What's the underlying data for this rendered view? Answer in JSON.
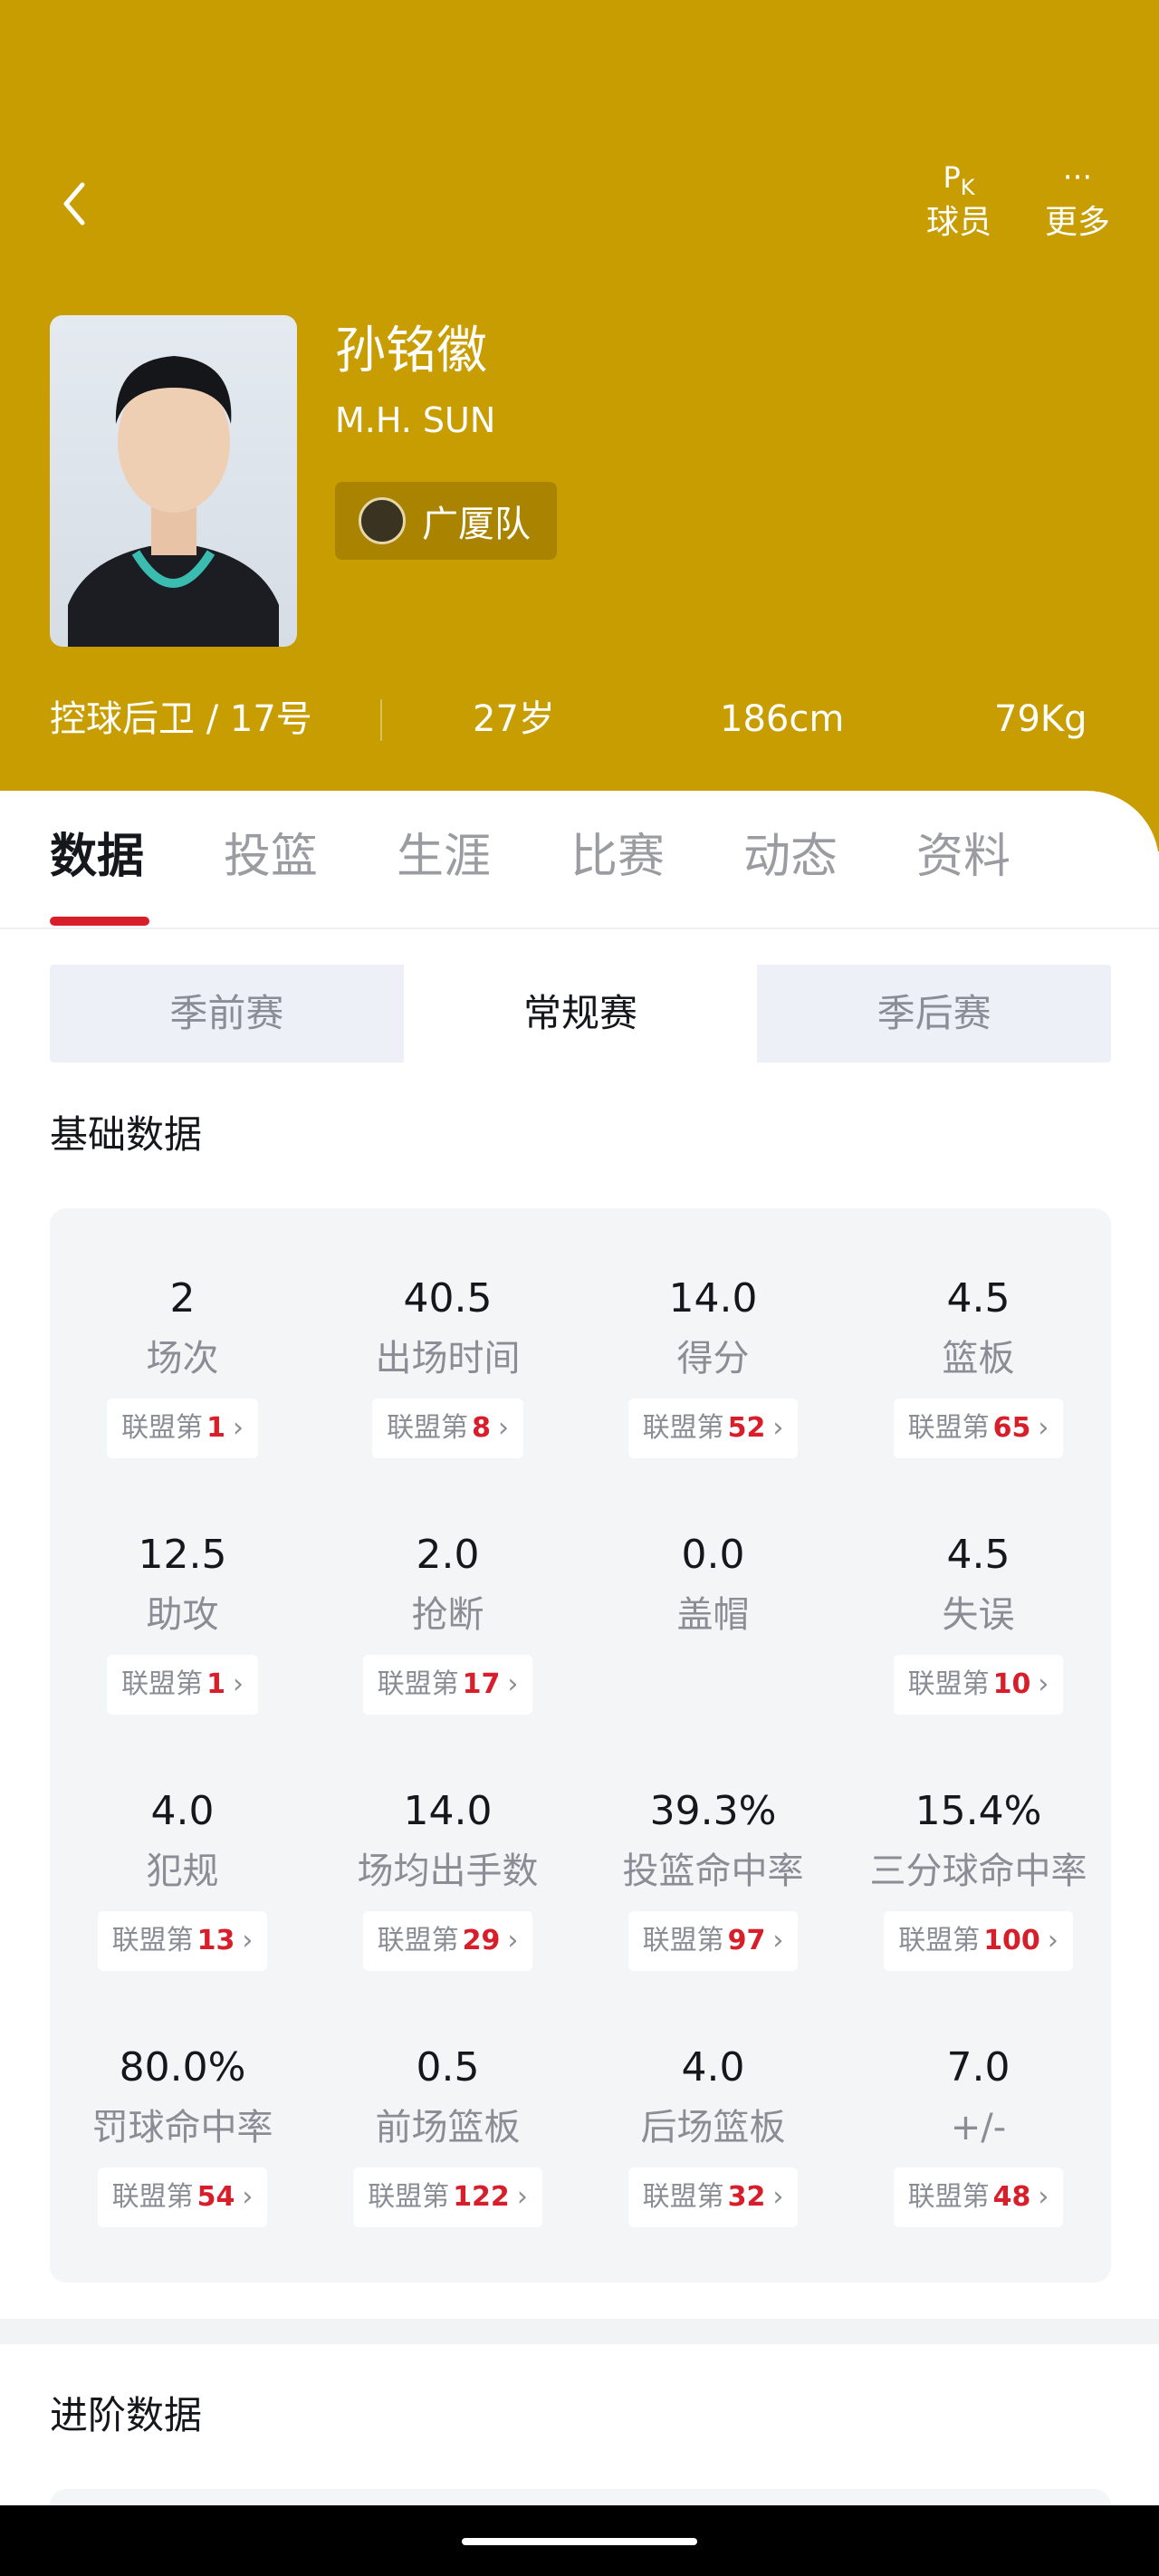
{
  "header": {
    "pk_icon": "PK",
    "pk_label": "球员",
    "more_icon": "···",
    "more_label": "更多",
    "bg_color": "#c89d02"
  },
  "player": {
    "name": "孙铭徽",
    "en_name": "M.H. SUN",
    "team": "广厦队",
    "position_number": "控球后卫 / 17号",
    "age": "27岁",
    "height": "186cm",
    "weight": "79Kg"
  },
  "tabs": [
    "数据",
    "投篮",
    "生涯",
    "比赛",
    "动态",
    "资料"
  ],
  "segments": [
    "季前赛",
    "常规赛",
    "季后赛"
  ],
  "basic_title": "基础数据",
  "advanced_title": "进阶数据",
  "rank_prefix": "联盟第",
  "accent_color": "#d81e2a",
  "stats": [
    {
      "value": "2",
      "label": "场次",
      "rank": "1"
    },
    {
      "value": "40.5",
      "label": "出场时间",
      "rank": "8"
    },
    {
      "value": "14.0",
      "label": "得分",
      "rank": "52"
    },
    {
      "value": "4.5",
      "label": "篮板",
      "rank": "65"
    },
    {
      "value": "12.5",
      "label": "助攻",
      "rank": "1"
    },
    {
      "value": "2.0",
      "label": "抢断",
      "rank": "17"
    },
    {
      "value": "0.0",
      "label": "盖帽",
      "rank": null
    },
    {
      "value": "4.5",
      "label": "失误",
      "rank": "10"
    },
    {
      "value": "4.0",
      "label": "犯规",
      "rank": "13"
    },
    {
      "value": "14.0",
      "label": "场均出手数",
      "rank": "29"
    },
    {
      "value": "39.3%",
      "label": "投篮命中率",
      "rank": "97"
    },
    {
      "value": "15.4%",
      "label": "三分球命中率",
      "rank": "100"
    },
    {
      "value": "80.0%",
      "label": "罚球命中率",
      "rank": "54"
    },
    {
      "value": "0.5",
      "label": "前场篮板",
      "rank": "122"
    },
    {
      "value": "4.0",
      "label": "后场篮板",
      "rank": "32"
    },
    {
      "value": "7.0",
      "label": "+/-",
      "rank": "48"
    }
  ]
}
